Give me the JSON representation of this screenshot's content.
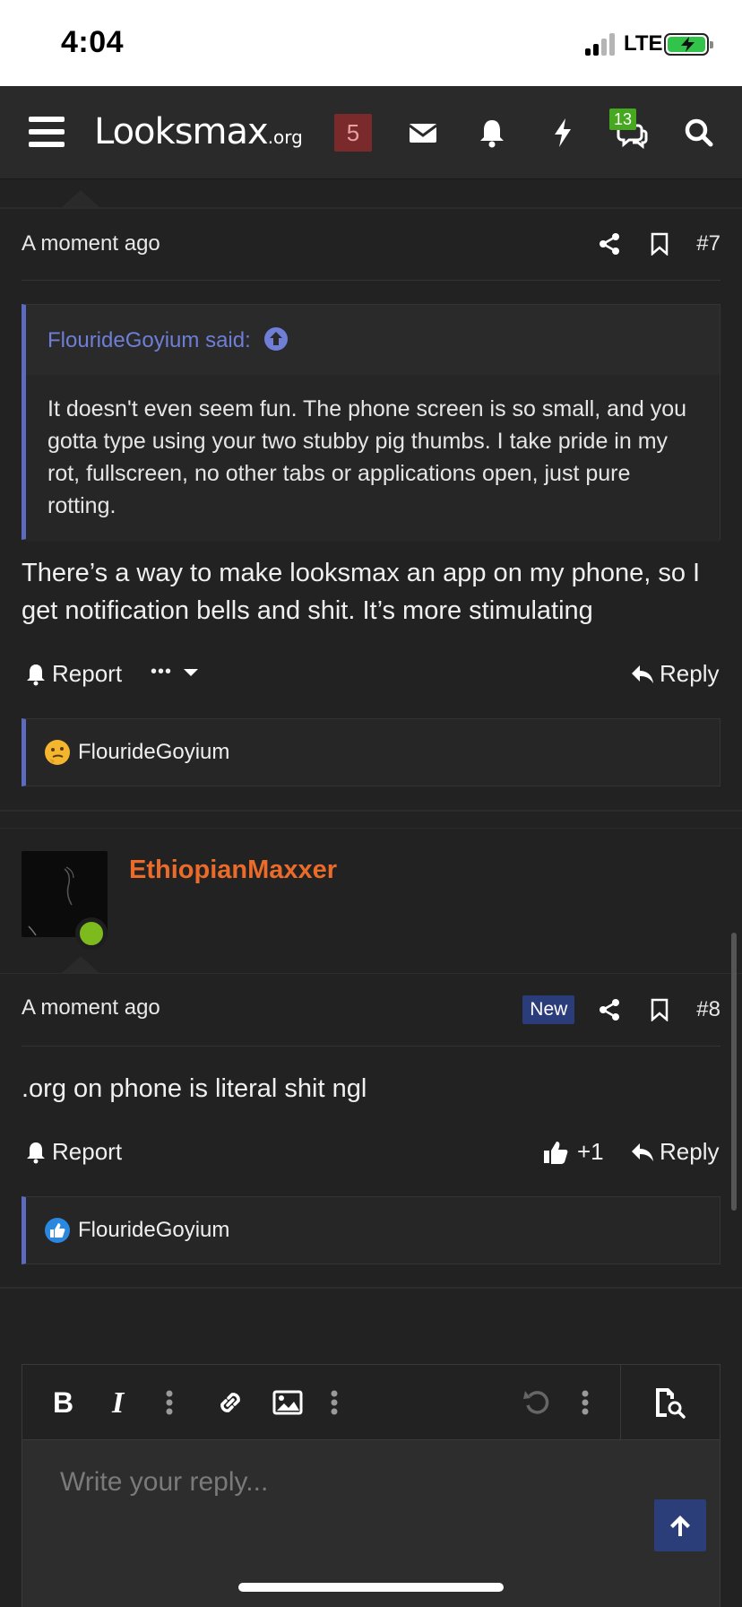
{
  "status": {
    "time": "4:04",
    "network": "LTE"
  },
  "nav": {
    "logo_main": "Looksmax",
    "logo_suffix": ".org",
    "alerts_badge": "5",
    "chat_badge": "13"
  },
  "post7": {
    "time": "A moment ago",
    "number": "#7",
    "quote_author": "FlourideGoyium said:",
    "quote_text": "It doesn't even seem fun. The phone screen is so small, and you gotta type using your two stubby pig thumbs. I take pride in my rot, fullscreen, no other tabs or applications open, just pure rotting.",
    "text": "There’s a way to make looksmax an app on my phone, so I get notification bells and shit. It’s more stimulating",
    "report_label": "Report",
    "more_label": "•••",
    "reply_label": "Reply",
    "reaction_user": "FlourideGoyium",
    "reaction_icon": "thinking-face-icon"
  },
  "post8": {
    "username": "EthiopianMaxxer",
    "time": "A moment ago",
    "new_label": "New",
    "number": "#8",
    "text": ".org on phone is literal shit ngl",
    "report_label": "Report",
    "like_count": "+1",
    "reply_label": "Reply",
    "reaction_user": "FlourideGoyium",
    "reaction_icon": "like-icon"
  },
  "editor": {
    "placeholder": "Write your reply..."
  },
  "colors": {
    "accent": "#5c6bc0",
    "username": "#ea6b2a",
    "online": "#7cba1e",
    "background": "#222222"
  }
}
